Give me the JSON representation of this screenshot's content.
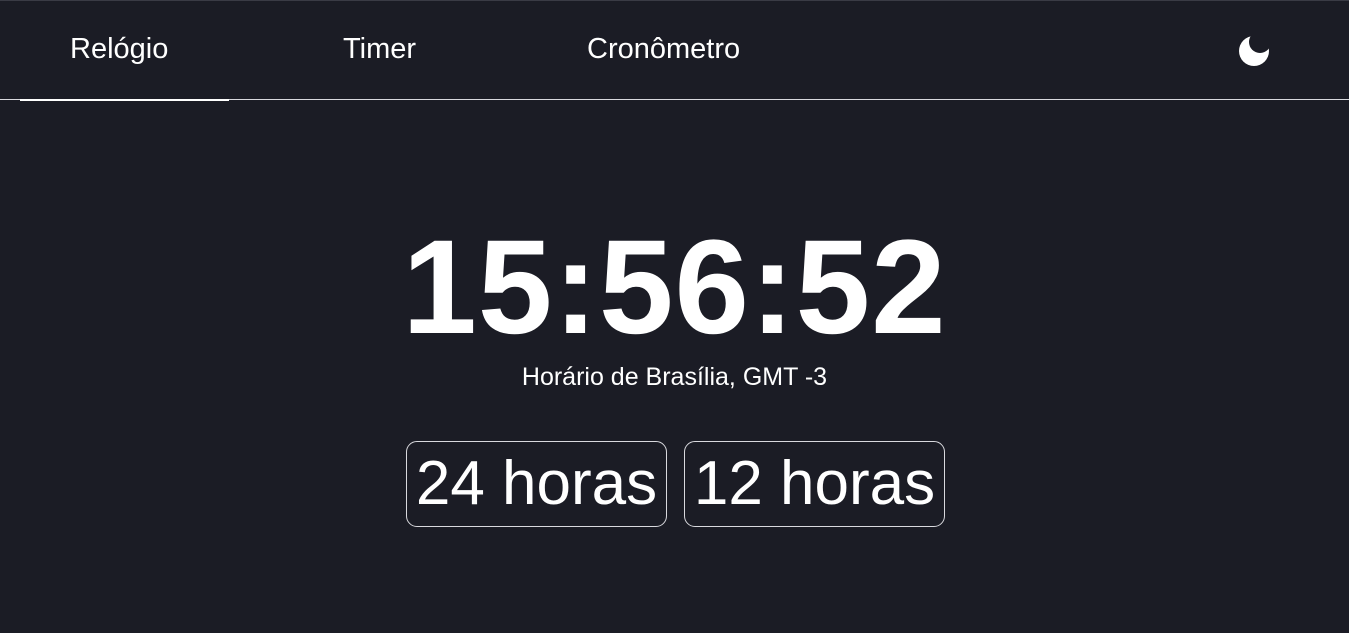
{
  "nav": {
    "tabs": [
      {
        "label": "Relógio",
        "active": true
      },
      {
        "label": "Timer",
        "active": false
      },
      {
        "label": "Cronômetro",
        "active": false
      }
    ],
    "theme_icon": "moon-icon"
  },
  "clock": {
    "time": "15:56:52",
    "timezone": "Horário de Brasília, GMT -3"
  },
  "format_buttons": {
    "h24": "24 horas",
    "h12": "12 horas"
  },
  "colors": {
    "background": "#1b1c25",
    "foreground": "#ffffff",
    "border": "#d9d9de"
  }
}
